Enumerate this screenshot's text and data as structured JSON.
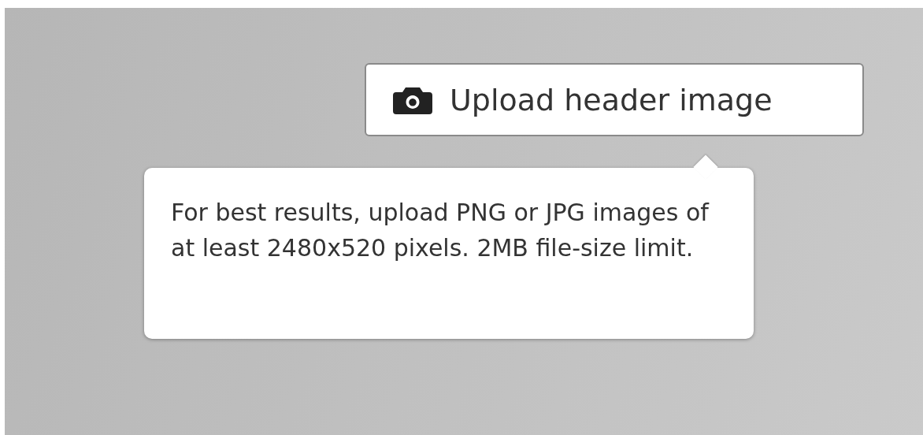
{
  "upload_button": {
    "label": "Upload header image"
  },
  "tooltip": {
    "text": "For best results, upload PNG or JPG images of at least 2480x520 pixels. 2MB file-size limit."
  }
}
